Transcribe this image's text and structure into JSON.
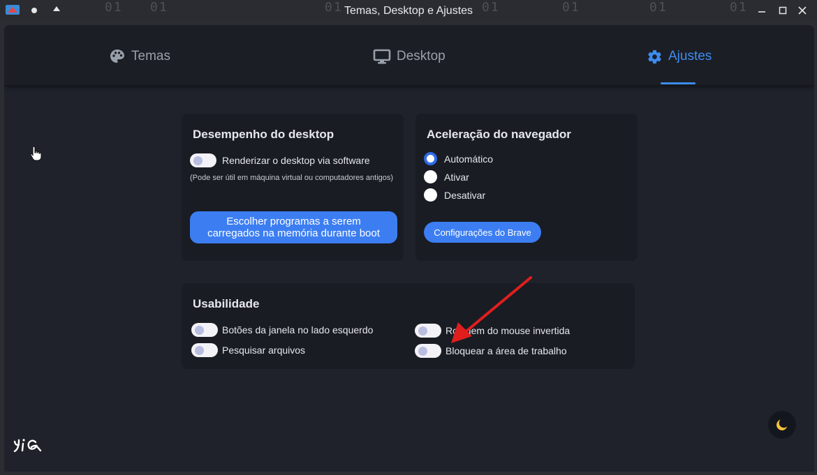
{
  "window": {
    "title": "Temas, Desktop e Ajustes"
  },
  "background": {
    "digits": [
      "01",
      "01",
      "01",
      "01",
      "01",
      "01",
      "01",
      "01",
      "01"
    ]
  },
  "tabs": [
    {
      "label": "Temas",
      "icon": "palette-icon"
    },
    {
      "label": "Desktop",
      "icon": "monitor-icon"
    },
    {
      "label": "Ajustes",
      "icon": "gear-icon",
      "active": true
    }
  ],
  "desktop_performance": {
    "title": "Desempenho do desktop",
    "software_render_label": "Renderizar o desktop via software",
    "software_render_note": "(Pode ser útil em máquina virtual ou computadores antigos)",
    "boot_programs_button": "Escolher programas a serem carregados na memória durante boot"
  },
  "browser_acceleration": {
    "title": "Aceleração do navegador",
    "options": [
      "Automático",
      "Ativar",
      "Desativar"
    ],
    "selected": "Automático",
    "brave_button": "Configurações do Brave"
  },
  "usability": {
    "title": "Usabilidade",
    "left_buttons_label": "Botões da janela no lado esquerdo",
    "search_files_label": "Pesquisar arquivos",
    "inverted_scroll_label": "Rolagem do mouse invertida",
    "lock_desktop_label": "Bloquear a área de trabalho"
  },
  "colors": {
    "accent": "#3d8cf0",
    "button": "#3c7ef2",
    "panel": "#191c23",
    "window": "#1f222a"
  }
}
